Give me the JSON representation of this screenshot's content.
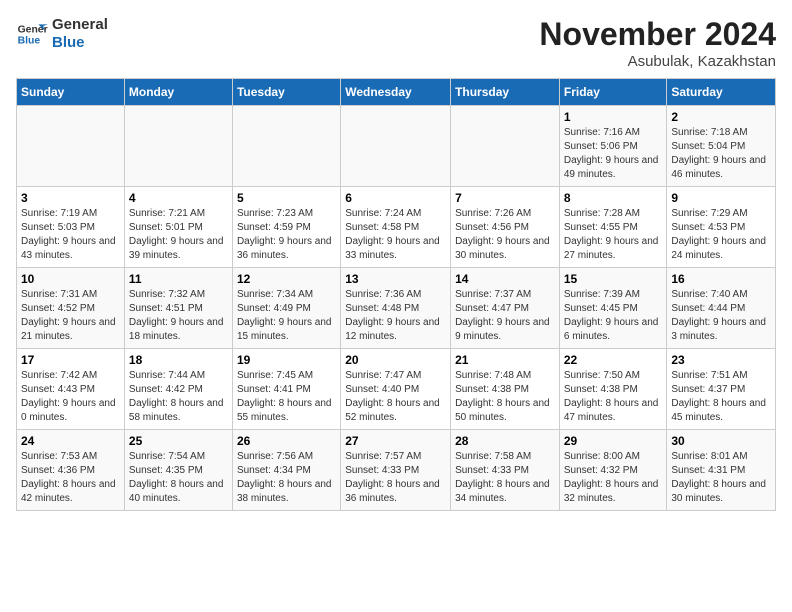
{
  "logo": {
    "line1": "General",
    "line2": "Blue"
  },
  "title": "November 2024",
  "subtitle": "Asubulak, Kazakhstan",
  "weekdays": [
    "Sunday",
    "Monday",
    "Tuesday",
    "Wednesday",
    "Thursday",
    "Friday",
    "Saturday"
  ],
  "weeks": [
    [
      {
        "day": "",
        "info": ""
      },
      {
        "day": "",
        "info": ""
      },
      {
        "day": "",
        "info": ""
      },
      {
        "day": "",
        "info": ""
      },
      {
        "day": "",
        "info": ""
      },
      {
        "day": "1",
        "info": "Sunrise: 7:16 AM\nSunset: 5:06 PM\nDaylight: 9 hours and 49 minutes."
      },
      {
        "day": "2",
        "info": "Sunrise: 7:18 AM\nSunset: 5:04 PM\nDaylight: 9 hours and 46 minutes."
      }
    ],
    [
      {
        "day": "3",
        "info": "Sunrise: 7:19 AM\nSunset: 5:03 PM\nDaylight: 9 hours and 43 minutes."
      },
      {
        "day": "4",
        "info": "Sunrise: 7:21 AM\nSunset: 5:01 PM\nDaylight: 9 hours and 39 minutes."
      },
      {
        "day": "5",
        "info": "Sunrise: 7:23 AM\nSunset: 4:59 PM\nDaylight: 9 hours and 36 minutes."
      },
      {
        "day": "6",
        "info": "Sunrise: 7:24 AM\nSunset: 4:58 PM\nDaylight: 9 hours and 33 minutes."
      },
      {
        "day": "7",
        "info": "Sunrise: 7:26 AM\nSunset: 4:56 PM\nDaylight: 9 hours and 30 minutes."
      },
      {
        "day": "8",
        "info": "Sunrise: 7:28 AM\nSunset: 4:55 PM\nDaylight: 9 hours and 27 minutes."
      },
      {
        "day": "9",
        "info": "Sunrise: 7:29 AM\nSunset: 4:53 PM\nDaylight: 9 hours and 24 minutes."
      }
    ],
    [
      {
        "day": "10",
        "info": "Sunrise: 7:31 AM\nSunset: 4:52 PM\nDaylight: 9 hours and 21 minutes."
      },
      {
        "day": "11",
        "info": "Sunrise: 7:32 AM\nSunset: 4:51 PM\nDaylight: 9 hours and 18 minutes."
      },
      {
        "day": "12",
        "info": "Sunrise: 7:34 AM\nSunset: 4:49 PM\nDaylight: 9 hours and 15 minutes."
      },
      {
        "day": "13",
        "info": "Sunrise: 7:36 AM\nSunset: 4:48 PM\nDaylight: 9 hours and 12 minutes."
      },
      {
        "day": "14",
        "info": "Sunrise: 7:37 AM\nSunset: 4:47 PM\nDaylight: 9 hours and 9 minutes."
      },
      {
        "day": "15",
        "info": "Sunrise: 7:39 AM\nSunset: 4:45 PM\nDaylight: 9 hours and 6 minutes."
      },
      {
        "day": "16",
        "info": "Sunrise: 7:40 AM\nSunset: 4:44 PM\nDaylight: 9 hours and 3 minutes."
      }
    ],
    [
      {
        "day": "17",
        "info": "Sunrise: 7:42 AM\nSunset: 4:43 PM\nDaylight: 9 hours and 0 minutes."
      },
      {
        "day": "18",
        "info": "Sunrise: 7:44 AM\nSunset: 4:42 PM\nDaylight: 8 hours and 58 minutes."
      },
      {
        "day": "19",
        "info": "Sunrise: 7:45 AM\nSunset: 4:41 PM\nDaylight: 8 hours and 55 minutes."
      },
      {
        "day": "20",
        "info": "Sunrise: 7:47 AM\nSunset: 4:40 PM\nDaylight: 8 hours and 52 minutes."
      },
      {
        "day": "21",
        "info": "Sunrise: 7:48 AM\nSunset: 4:38 PM\nDaylight: 8 hours and 50 minutes."
      },
      {
        "day": "22",
        "info": "Sunrise: 7:50 AM\nSunset: 4:38 PM\nDaylight: 8 hours and 47 minutes."
      },
      {
        "day": "23",
        "info": "Sunrise: 7:51 AM\nSunset: 4:37 PM\nDaylight: 8 hours and 45 minutes."
      }
    ],
    [
      {
        "day": "24",
        "info": "Sunrise: 7:53 AM\nSunset: 4:36 PM\nDaylight: 8 hours and 42 minutes."
      },
      {
        "day": "25",
        "info": "Sunrise: 7:54 AM\nSunset: 4:35 PM\nDaylight: 8 hours and 40 minutes."
      },
      {
        "day": "26",
        "info": "Sunrise: 7:56 AM\nSunset: 4:34 PM\nDaylight: 8 hours and 38 minutes."
      },
      {
        "day": "27",
        "info": "Sunrise: 7:57 AM\nSunset: 4:33 PM\nDaylight: 8 hours and 36 minutes."
      },
      {
        "day": "28",
        "info": "Sunrise: 7:58 AM\nSunset: 4:33 PM\nDaylight: 8 hours and 34 minutes."
      },
      {
        "day": "29",
        "info": "Sunrise: 8:00 AM\nSunset: 4:32 PM\nDaylight: 8 hours and 32 minutes."
      },
      {
        "day": "30",
        "info": "Sunrise: 8:01 AM\nSunset: 4:31 PM\nDaylight: 8 hours and 30 minutes."
      }
    ]
  ]
}
